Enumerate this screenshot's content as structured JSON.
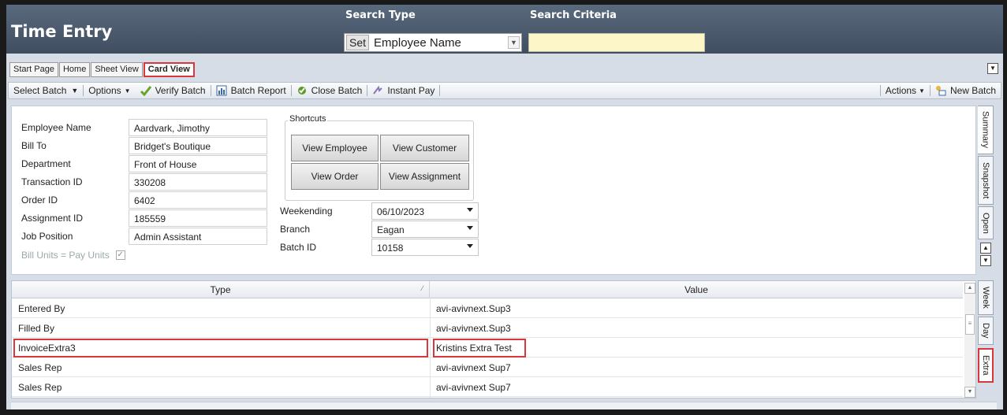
{
  "app": {
    "title": "Time Entry"
  },
  "search": {
    "type_label": "Search Type",
    "criteria_label": "Search Criteria",
    "set_button": "Set",
    "type_value": "Employee Name",
    "criteria_value": ""
  },
  "tabs": [
    {
      "label": "Start Page"
    },
    {
      "label": "Home"
    },
    {
      "label": "Sheet View"
    },
    {
      "label": "Card View",
      "active": true
    }
  ],
  "toolbar": {
    "select_batch": "Select Batch",
    "options": "Options",
    "verify_batch": "Verify Batch",
    "batch_report": "Batch Report",
    "close_batch": "Close Batch",
    "instant_pay": "Instant Pay",
    "actions": "Actions",
    "new_batch": "New Batch"
  },
  "form": {
    "fields": [
      {
        "label": "Employee Name",
        "value": "Aardvark, Jimothy"
      },
      {
        "label": "Bill To",
        "value": "Bridget's Boutique"
      },
      {
        "label": "Department",
        "value": "Front of House"
      },
      {
        "label": "Transaction ID",
        "value": "330208"
      },
      {
        "label": "Order ID",
        "value": "6402"
      },
      {
        "label": "Assignment ID",
        "value": "185559"
      },
      {
        "label": "Job Position",
        "value": "Admin Assistant"
      }
    ],
    "bill_units_label": "Bill Units = Pay Units",
    "bill_units_checked": true
  },
  "shortcuts": {
    "label": "Shortcuts",
    "view_employee": "View Employee",
    "view_customer": "View Customer",
    "view_order": "View Order",
    "view_assignment": "View Assignment"
  },
  "batch": {
    "weekending_label": "Weekending",
    "weekending_value": "06/10/2023",
    "branch_label": "Branch",
    "branch_value": "Eagan",
    "batch_id_label": "Batch ID",
    "batch_id_value": "10158"
  },
  "side_tabs_top": [
    "Summary",
    "Snapshot",
    "Open"
  ],
  "side_tabs_bottom": [
    "Week",
    "Day",
    "Extra"
  ],
  "grid": {
    "columns": [
      "Type",
      "Value"
    ],
    "rows": [
      {
        "type": "Entered By",
        "value": "avi-avivnext.Sup3"
      },
      {
        "type": "Filled By",
        "value": "avi-avivnext.Sup3"
      },
      {
        "type": "InvoiceExtra3",
        "value": "Kristins Extra Test",
        "highlighted": true
      },
      {
        "type": "Sales Rep",
        "value": "avi-avivnext Sup7"
      },
      {
        "type": "Sales Rep",
        "value": "avi-avivnext Sup7"
      }
    ]
  },
  "colors": {
    "highlight": "#d9363e",
    "title_bar": "#4a5a6e",
    "criteria_field": "#fdf6c8"
  }
}
